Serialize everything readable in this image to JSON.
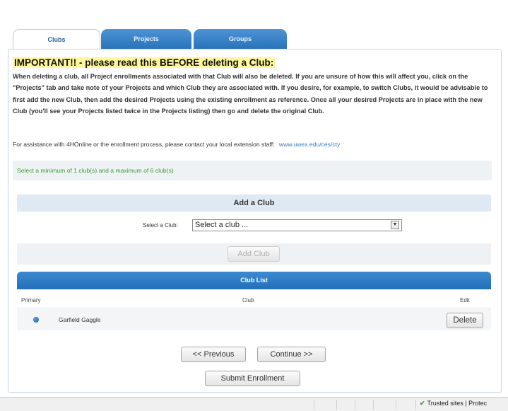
{
  "tabs": [
    {
      "label": "Clubs"
    },
    {
      "label": "Projects"
    },
    {
      "label": "Groups"
    }
  ],
  "notice": {
    "heading": "IMPORTANT!! - please read this BEFORE deleting a Club:",
    "body": "When deleting a club, all Project enrollments associated with that Club will also be deleted.  If you are unsure of how this will affect you, click on the \"Projects\" tab and take note of your Projects and which Club they are associated with.  If you desire, for example, to switch Clubs, it would be advisable to first add the new Club, then add the desired Projects using the existing enrollment as reference.  Once all your desired Projects are in place with the new Club (you'll see your Projects listed twice in the Projects listing) then go and delete the original Club.",
    "assistance": "For assistance with 4HOnline or the enrollment process, please contact your local extension staff:",
    "assistance_link": "www.uwex.edu/ces/cty"
  },
  "limits": {
    "text": "Select a minimum of 1 club(s) and a maximum of 6 club(s)"
  },
  "add_club": {
    "heading": "Add a Club",
    "select_label": "Select a Club:",
    "select_value": "Select a club ...",
    "button": "Add Club"
  },
  "club_list": {
    "heading": "Club List",
    "columns": {
      "primary": "Primary",
      "club": "Club",
      "edit": "Edit"
    },
    "rows": [
      {
        "club": "Garfield Gaggle",
        "primary": true,
        "action": "Delete"
      }
    ]
  },
  "nav": {
    "previous": "<< Previous",
    "continue": "Continue >>",
    "submit": "Submit Enrollment"
  },
  "status": {
    "zone": "Trusted sites | Protec"
  },
  "colors": {
    "tab_blue": "#2872b8",
    "highlight": "#fff799",
    "success_green": "#3d9a33"
  }
}
